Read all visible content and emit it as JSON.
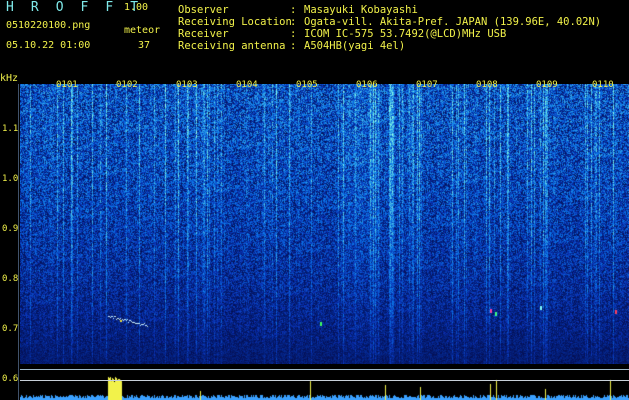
{
  "header": {
    "title": "H R O F F T",
    "version": "1.00",
    "file": "0510220100.png",
    "datetime": "05.10.22 01:00",
    "meteor_label": "meteor",
    "meteor_count": "37"
  },
  "info": [
    {
      "key": "Observer",
      "value": "Masayuki Kobayashi"
    },
    {
      "key": "Receiving Location",
      "value": "Ogata-vill. Akita-Pref. JAPAN (139.96E, 40.02N)"
    },
    {
      "key": "Receiver",
      "value": "ICOM IC-575 53.7492(@LCD)MHz USB"
    },
    {
      "key": "Receiving antenna",
      "value": "A504HB(yagi 4el)"
    }
  ],
  "info_separator": ":",
  "y_axis": {
    "unit": "kHz",
    "ticks": [
      "1.1",
      "1.0",
      "0.9",
      "0.8",
      "0.7",
      "0.6"
    ]
  },
  "x_axis": {
    "ticks": [
      "0101",
      "0102",
      "0103",
      "0104",
      "0105",
      "0106",
      "0107",
      "0108",
      "0109",
      "0110"
    ]
  },
  "colors": {
    "text_cyan": "#7fe9e9",
    "text_yellow": "#f2f24a",
    "background": "#000000",
    "spectrum_low": "#0a1a6e",
    "spectrum_mid": "#1e50d8",
    "spectrum_high": "#32c8f0"
  }
}
